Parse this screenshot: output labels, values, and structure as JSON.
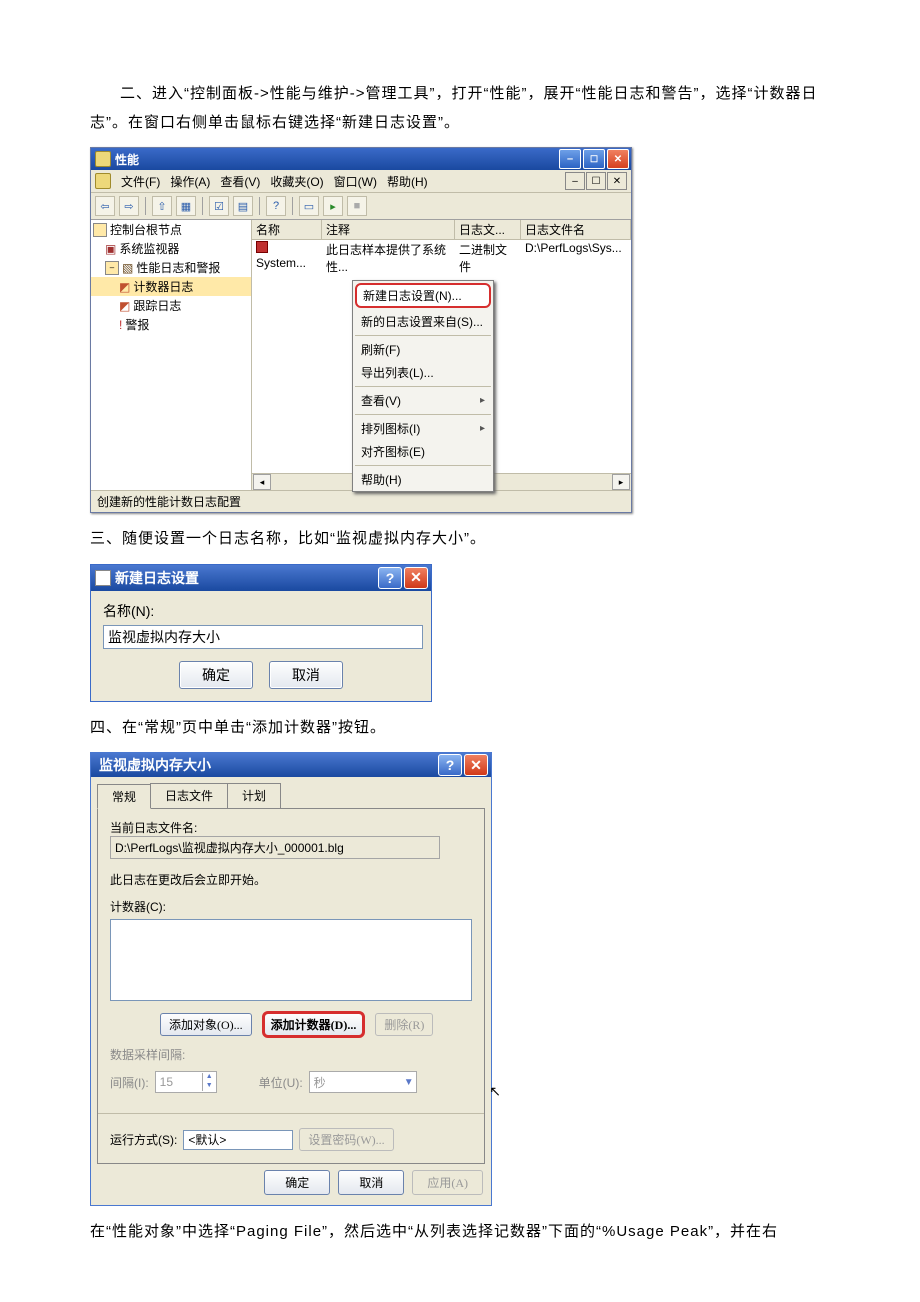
{
  "para1": "二、进入“控制面板->性能与维护->管理工具”，打开“性能”，展开“性能日志和警告”，选择“计数器日志”。在窗口右侧单击鼠标右键选择“新建日志设置”。",
  "para2": "三、随便设置一个日志名称，比如“监视虚拟内存大小”。",
  "para3": "四、在“常规”页中单击“添加计数器”按钮。",
  "para4": "在“性能对象”中选择“Paging File”，然后选中“从列表选择记数器”下面的“%Usage Peak”，并在右",
  "win1": {
    "title": "性能",
    "menus": [
      "文件(F)",
      "操作(A)",
      "查看(V)",
      "收藏夹(O)",
      "窗口(W)",
      "帮助(H)"
    ],
    "tree": {
      "root": "控制台根节点",
      "n1": "系统监视器",
      "n2": "性能日志和警报",
      "n2a": "计数器日志",
      "n2b": "跟踪日志",
      "n2c": "警报"
    },
    "cols": {
      "name": "名称",
      "note": "注释",
      "type": "日志文...",
      "file": "日志文件名"
    },
    "row": {
      "name": "System...",
      "note": "此日志样本提供了系统性...",
      "type": "二进制文件",
      "file": "D:\\PerfLogs\\Sys..."
    },
    "ctx": {
      "new": "新建日志设置(N)...",
      "from": "新的日志设置来自(S)...",
      "refresh": "刷新(F)",
      "export": "导出列表(L)...",
      "view": "查看(V)",
      "arrange": "排列图标(I)",
      "align": "对齐图标(E)",
      "help": "帮助(H)"
    },
    "status": "创建新的性能计数日志配置"
  },
  "dlg2": {
    "title": "新建日志设置",
    "namelbl": "名称(N):",
    "nameval": "监视虚拟内存大小",
    "ok": "确定",
    "cancel": "取消"
  },
  "dlg3": {
    "title": "监视虚拟内存大小",
    "tabs": {
      "general": "常规",
      "logfile": "日志文件",
      "schedule": "计划"
    },
    "curfile_lbl": "当前日志文件名:",
    "curfile_val": "D:\\PerfLogs\\监视虚拟内存大小_000001.blg",
    "note": "此日志在更改后会立即开始。",
    "counters_lbl": "计数器(C):",
    "btn_addobj": "添加对象(O)...",
    "btn_addctr": "添加计数器(D)...",
    "btn_remove": "删除(R)",
    "sample_lbl": "数据采样间隔:",
    "interval_lbl": "间隔(I):",
    "interval_val": "15",
    "unit_lbl": "单位(U):",
    "unit_val": "秒",
    "runas_lbl": "运行方式(S):",
    "runas_val": "<默认>",
    "setpwd": "设置密码(W)...",
    "ok": "确定",
    "cancel": "取消",
    "apply": "应用(A)"
  }
}
